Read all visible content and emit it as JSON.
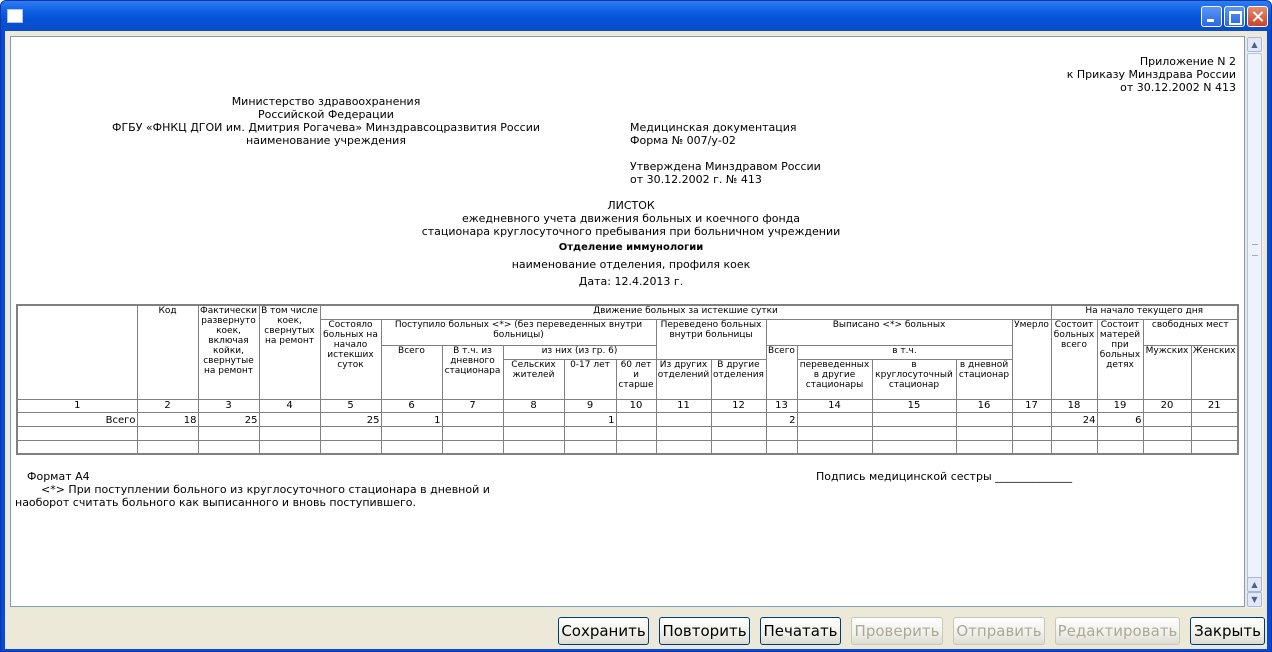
{
  "buttons": {
    "save": "Сохранить",
    "repeat": "Повторить",
    "print": "Печатать",
    "check": "Проверить",
    "send": "Отправить",
    "edit": "Редактировать",
    "close": "Закрыть"
  },
  "doc": {
    "appendix": [
      "Приложение N 2",
      "к Приказу Минздрава России",
      "от 30.12.2002 N 413"
    ],
    "ministry": [
      "Министерство здравоохранения",
      "Российской Федерации",
      "ФГБУ «ФНКЦ ДГОИ им. Дмитрия Рогачева» Минздравсоцразвития России",
      "наименование учреждения"
    ],
    "form": [
      "Медицинская документация",
      "Форма № 007/у-02",
      "",
      "Утверждена Минздравом России",
      "от 30.12.2002 г. № 413"
    ],
    "title": [
      "ЛИСТОК",
      "ежедневного учета движения больных и коечного фонда",
      "стационара круглосуточного пребывания при больничном учреждении"
    ],
    "department": "Отделение иммунологии",
    "department_caption": "наименование отделения, профиля коек",
    "date": "Дата: 12.4.2013 г.",
    "format": "Формат А4",
    "note1": "<*>  При поступлении больного из круглосуточного стационара в дневной и",
    "note2": "наоборот считать больного как выписанного и вновь поступившего.",
    "signature": "Подпись медицинской сестры ______________"
  },
  "table": {
    "h_code": "Код",
    "h_deployed": "Фактически развернуто коек, включая койки, свернутые на ремонт",
    "h_folded": "В том числе коек, свернутых на ремонт",
    "h_movement": "Движение больных за истекшие сутки",
    "h_start": "На начало текущего дня",
    "h_was": "Состояло больных на начало истекших суток",
    "h_admitted": "Поступило больных <*> (без переведенных внутри больницы)",
    "h_transferred": "Переведено больных внутри больницы",
    "h_discharged": "Выписано <*> больных",
    "h_died": "Умерло",
    "h_patients": "Состоит больных всего",
    "h_mothers": "Состоит матерей при больных детях",
    "h_free": "свободных мест",
    "h_total": "Всего",
    "h_day": "В т.ч. из дневного стационара",
    "h_of_them": "из них (из гр. 6)",
    "h_rural": "Сельских жителей",
    "h_age017": "0-17 лет",
    "h_age60": "60 лет и старше",
    "h_from_other": "Из других отделений",
    "h_to_other": "В другие отделения",
    "h_total13": "Всего",
    "h_incl": "в т.ч.",
    "h_to_hosp": "переведенных в другие стационары",
    "h_to_round": "в круглосуточный стационар",
    "h_to_dayhosp": "в дневной стационар",
    "h_men": "Мужских",
    "h_women": "Женских",
    "col_numbers": [
      "1",
      "2",
      "3",
      "4",
      "5",
      "6",
      "7",
      "8",
      "9",
      "10",
      "11",
      "12",
      "13",
      "14",
      "15",
      "16",
      "17",
      "18",
      "19",
      "20",
      "21"
    ],
    "rows": [
      [
        "Всего",
        "18",
        "25",
        "",
        "25",
        "1",
        "",
        "",
        "1",
        "",
        "",
        "",
        "2",
        "",
        "",
        "",
        "",
        "24",
        "6",
        "",
        ""
      ],
      [
        "",
        "",
        "",
        "",
        "",
        "",
        "",
        "",
        "",
        "",
        "",
        "",
        "",
        "",
        "",
        "",
        "",
        "",
        "",
        "",
        ""
      ],
      [
        "",
        "",
        "",
        "",
        "",
        "",
        "",
        "",
        "",
        "",
        "",
        "",
        "",
        "",
        "",
        "",
        "",
        "",
        "",
        "",
        ""
      ]
    ]
  }
}
